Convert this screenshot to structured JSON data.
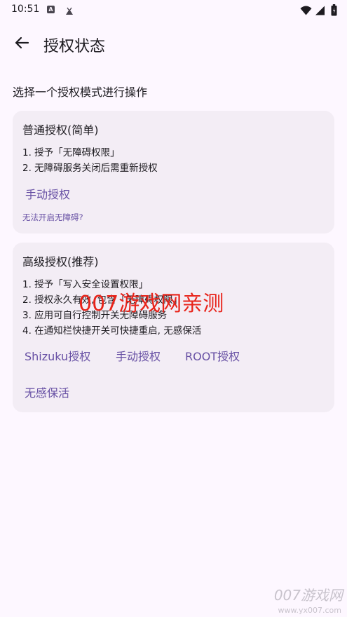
{
  "status_bar": {
    "time": "10:51",
    "notif_icon_a": "A"
  },
  "app_bar": {
    "title": "授权状态"
  },
  "subtitle": "选择一个授权模式进行操作",
  "cards": [
    {
      "title": "普通授权(简单)",
      "lines": [
        "1. 授予「无障碍权限」",
        "2. 无障碍服务关闭后需重新授权"
      ],
      "buttons": [
        "手动授权"
      ],
      "help_link": "无法开启无障碍?"
    },
    {
      "title": "高级授权(推荐)",
      "lines": [
        "1. 授予「写入安全设置权限」",
        "2. 授权永久有效, 包含「无障碍权限」",
        "3. 应用可自行控制开关无障碍服务",
        "4. 在通知栏快捷开关可快捷重启, 无感保活"
      ],
      "buttons": [
        "Shizuku授权",
        "手动授权",
        "ROOT授权",
        "无感保活"
      ]
    }
  ],
  "watermark": {
    "center": "007游戏网亲测",
    "corner": "007游戏网",
    "url": "www.yx007.com"
  },
  "colors": {
    "background": "#FDF7FF",
    "card": "#F3EDF5",
    "accent": "#6750A4",
    "watermark_red": "#E8231A"
  }
}
